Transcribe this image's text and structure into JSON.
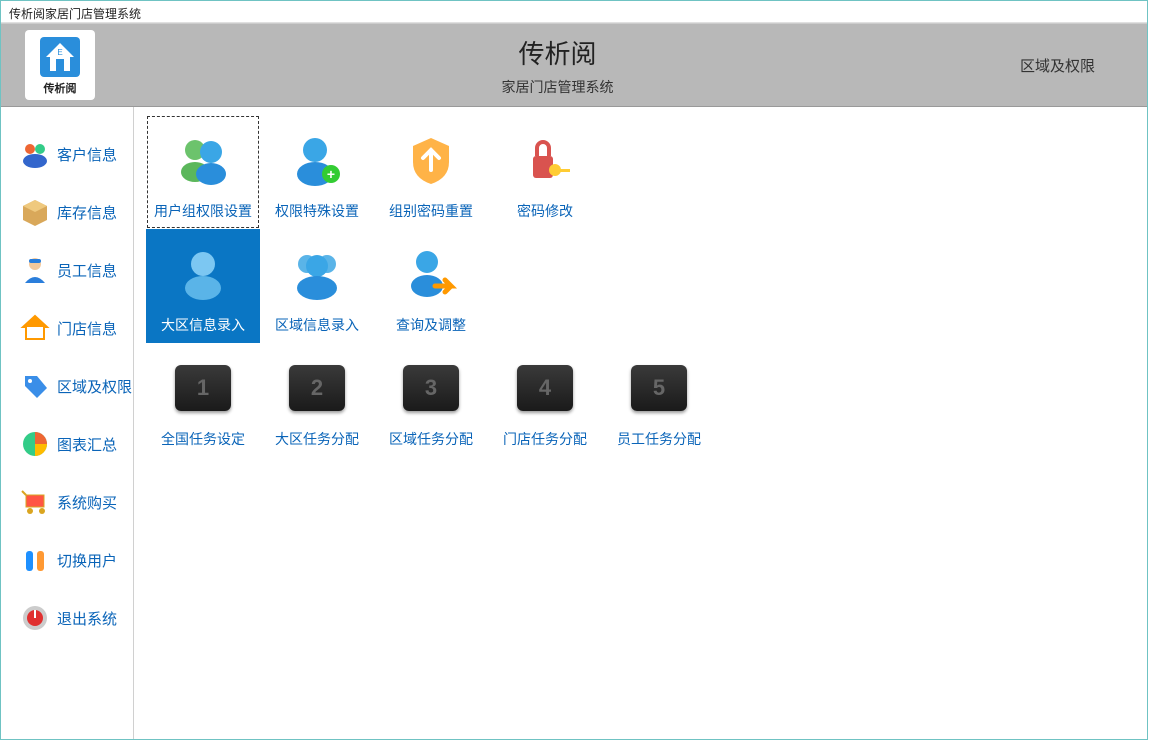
{
  "window_title": "传析阅家居门店管理系统",
  "header": {
    "logo_label": "传析阅",
    "title": "传析阅",
    "subtitle": "家居门店管理系统",
    "section": "区域及权限"
  },
  "sidebar": {
    "items": [
      {
        "label": "客户信息",
        "icon": "customers"
      },
      {
        "label": "库存信息",
        "icon": "box"
      },
      {
        "label": "员工信息",
        "icon": "person"
      },
      {
        "label": "门店信息",
        "icon": "house"
      },
      {
        "label": "区域及权限",
        "icon": "tag"
      },
      {
        "label": "图表汇总",
        "icon": "chart"
      },
      {
        "label": "系统购买",
        "icon": "cart"
      },
      {
        "label": "切换用户",
        "icon": "switch-user"
      },
      {
        "label": "退出系统",
        "icon": "power"
      }
    ]
  },
  "tiles": {
    "row1": [
      {
        "label": "用户组权限设置",
        "icon": "users-group",
        "state": "focus"
      },
      {
        "label": "权限特殊设置",
        "icon": "user-add"
      },
      {
        "label": "组别密码重置",
        "icon": "shield-up"
      },
      {
        "label": "密码修改",
        "icon": "lock-key"
      }
    ],
    "row2": [
      {
        "label": "大区信息录入",
        "icon": "user-single",
        "state": "selected"
      },
      {
        "label": "区域信息录入",
        "icon": "users-blue"
      },
      {
        "label": "查询及调整",
        "icon": "user-arrow"
      }
    ],
    "row3": [
      {
        "label": "全国任务设定",
        "num": "1"
      },
      {
        "label": "大区任务分配",
        "num": "2"
      },
      {
        "label": "区域任务分配",
        "num": "3"
      },
      {
        "label": "门店任务分配",
        "num": "4"
      },
      {
        "label": "员工任务分配",
        "num": "5"
      }
    ]
  }
}
